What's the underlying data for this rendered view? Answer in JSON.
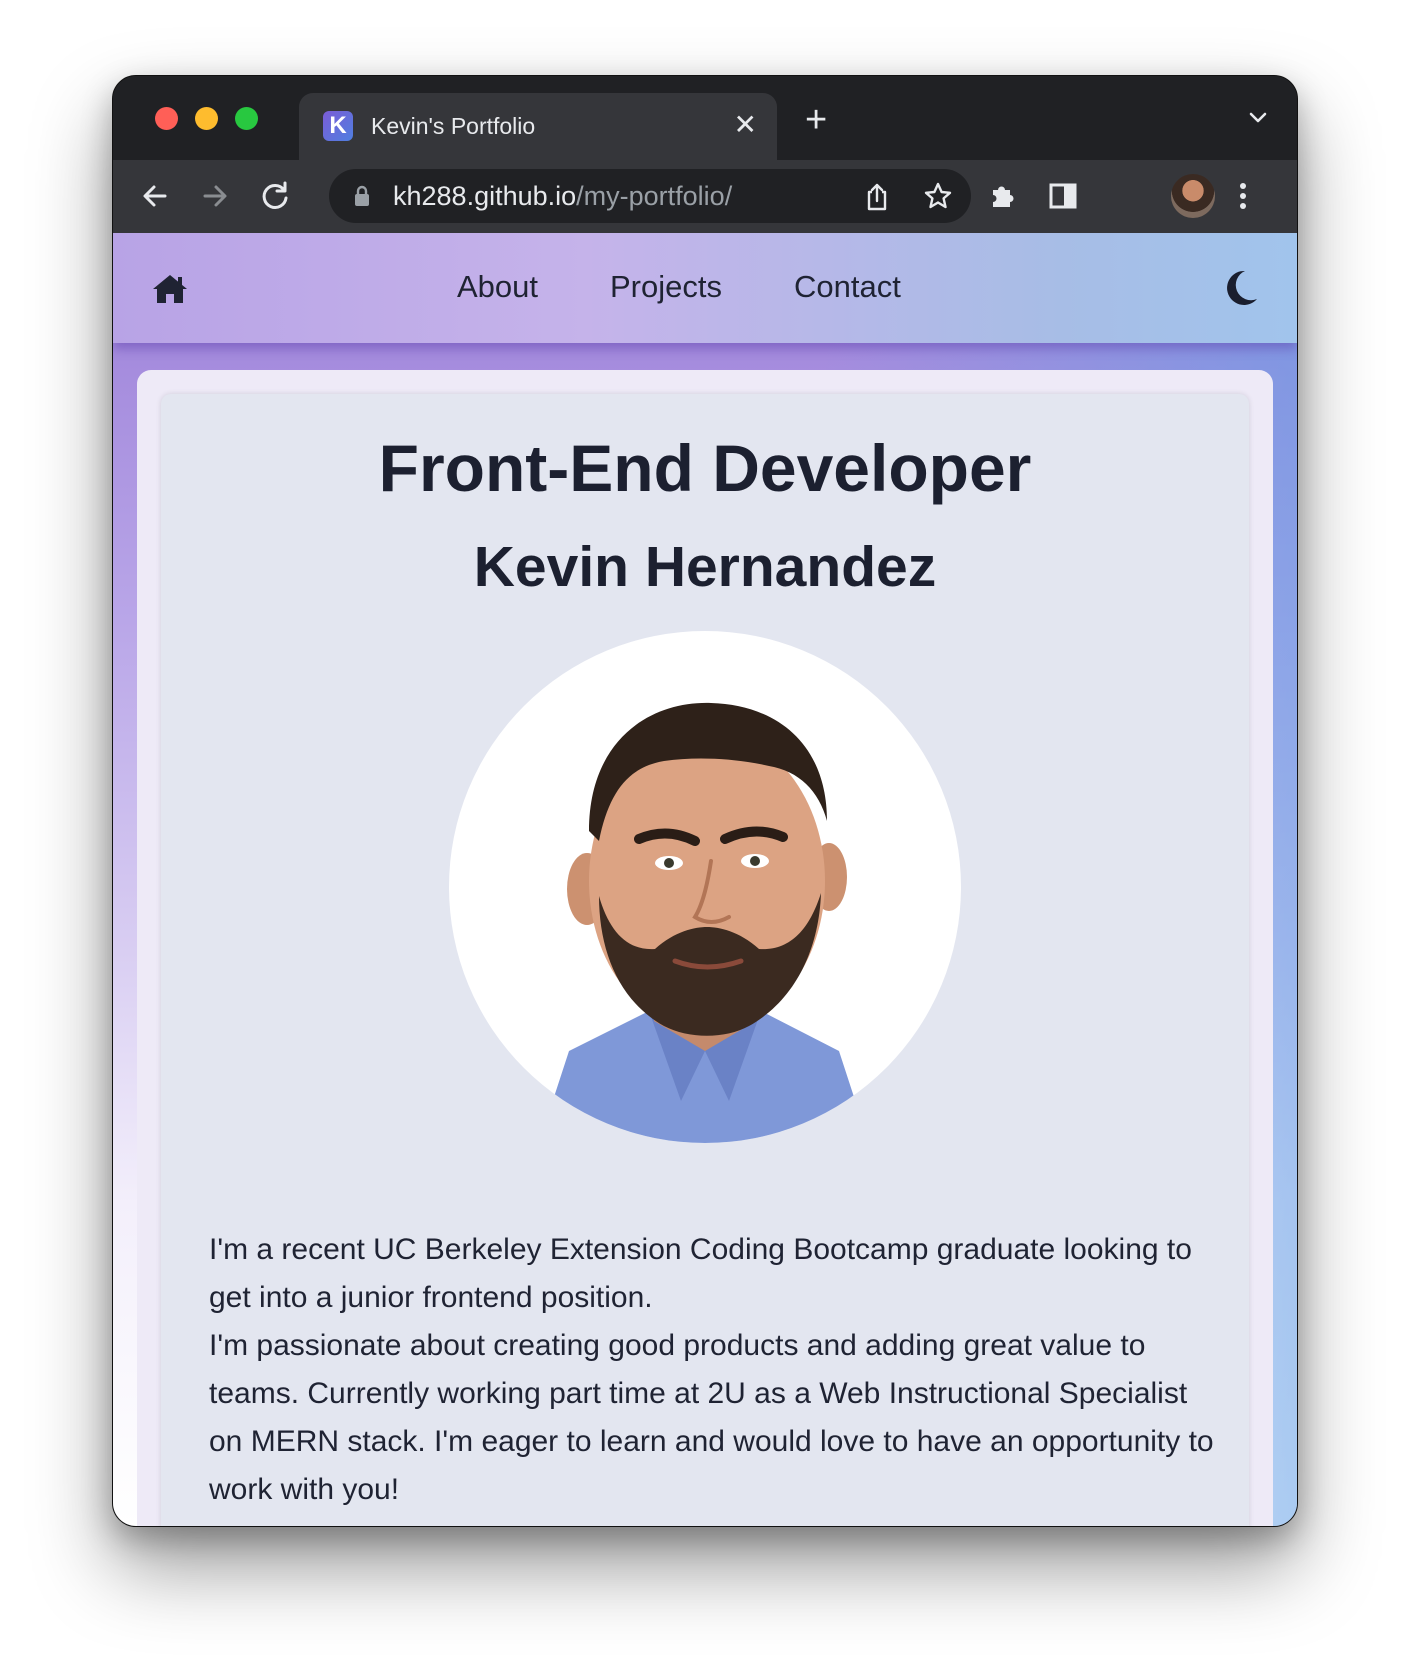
{
  "browser": {
    "tab_title": "Kevin's Portfolio",
    "tab_favicon_letter": "K",
    "url_host": "kh288.github.io",
    "url_path": "/my-portfolio/"
  },
  "nav": {
    "links": [
      "About",
      "Projects",
      "Contact"
    ]
  },
  "hero": {
    "headline": "Front-End Developer",
    "name": "Kevin Hernandez"
  },
  "bio": {
    "line1": "I'm a recent UC Berkeley Extension Coding Bootcamp graduate looking to get into a junior frontend position.",
    "line2": "I'm passionate about creating good products and adding great value to teams. Currently working part time at 2U as a Web Instructional Specialist on MERN stack. I'm eager to learn and would love to have an opportunity to work with you!"
  },
  "colors": {
    "accent_purple": "#9b7fd8",
    "nav_text": "#1f2333",
    "card_bg": "#e3e6f0"
  },
  "icons": [
    "home-icon",
    "moon-icon",
    "back-arrow-icon",
    "forward-arrow-icon",
    "reload-icon",
    "lock-icon",
    "share-icon",
    "star-icon",
    "extensions-icon",
    "side-panel-icon",
    "more-icon",
    "close-icon",
    "plus-icon",
    "chevron-down-icon"
  ]
}
